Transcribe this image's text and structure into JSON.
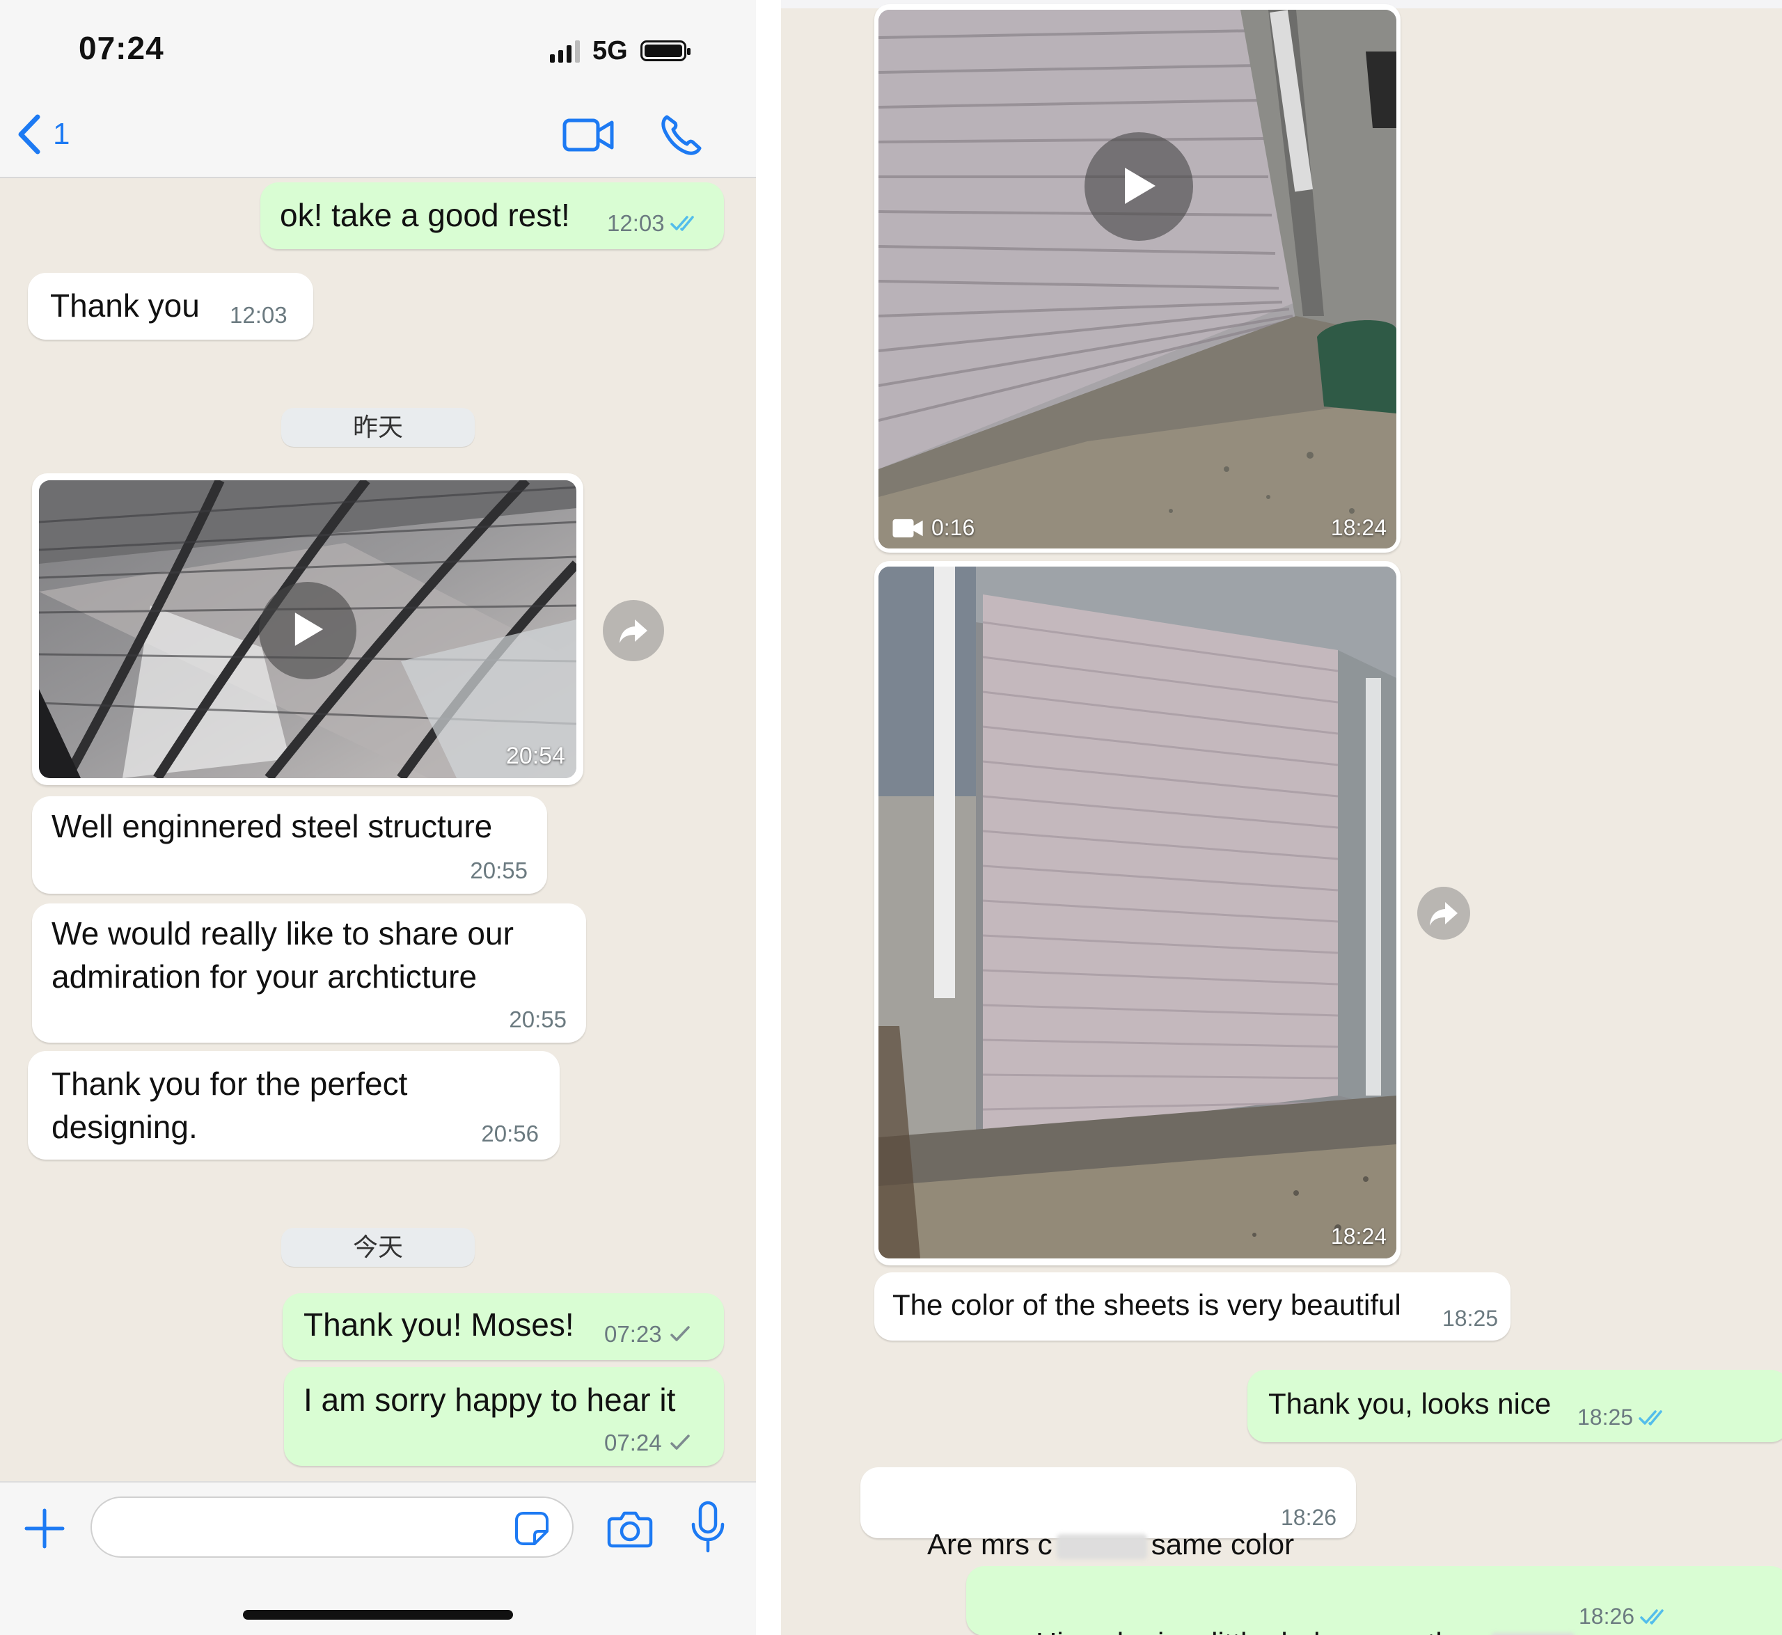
{
  "left": {
    "status_bar": {
      "time": "07:24",
      "network": "5G"
    },
    "nav": {
      "back_count": "1"
    },
    "day_labels": {
      "yesterday": "昨天",
      "today": "今天"
    },
    "messages": [
      {
        "text": "ok! take a good rest!",
        "time": "12:03",
        "direction": "outgoing",
        "status": "read"
      },
      {
        "text": "Thank you",
        "time": "12:03",
        "direction": "incoming"
      },
      {
        "type": "video",
        "time": "20:54",
        "direction": "incoming"
      },
      {
        "text": "Well enginnered steel structure",
        "time": "20:55",
        "direction": "incoming"
      },
      {
        "text": "We would really like to share our\nadmiration for your archticture",
        "time": "20:55",
        "direction": "incoming"
      },
      {
        "text": "Thank you for the perfect\ndesigning.",
        "time": "20:56",
        "direction": "incoming"
      },
      {
        "text": "Thank you! Moses!",
        "time": "07:23",
        "direction": "outgoing",
        "status": "sent"
      },
      {
        "text": "I am sorry happy to hear it",
        "time": "07:24",
        "direction": "outgoing",
        "status": "sent"
      }
    ],
    "input": {
      "placeholder": ""
    }
  },
  "right": {
    "messages": [
      {
        "type": "video",
        "duration": "0:16",
        "time": "18:24",
        "direction": "incoming"
      },
      {
        "type": "image",
        "time": "18:24",
        "direction": "incoming"
      },
      {
        "text": "The color of the sheets is very beautiful",
        "time": "18:25",
        "direction": "incoming"
      },
      {
        "text": "Thank you, looks nice",
        "time": "18:25",
        "direction": "outgoing",
        "status": "read"
      },
      {
        "text_before": "Are mrs c",
        "text_after": "same color",
        "time": "18:26",
        "direction": "incoming"
      },
      {
        "text_before": "His color is a little darker grey than",
        "time": "18:26",
        "direction": "outgoing",
        "status": "read"
      }
    ]
  },
  "colors": {
    "accent": "#1d7af3",
    "outgoing_bubble": "#d9fdd3",
    "incoming_bubble": "#ffffff",
    "chat_background": "#efeae2",
    "read_tick": "#53bdeb"
  },
  "icons": [
    "back-chevron-icon",
    "video-call-icon",
    "phone-call-icon",
    "play-icon",
    "forward-icon",
    "video-camera-icon",
    "plus-icon",
    "sticker-icon",
    "camera-icon",
    "microphone-icon",
    "double-check-icon",
    "single-check-icon"
  ]
}
